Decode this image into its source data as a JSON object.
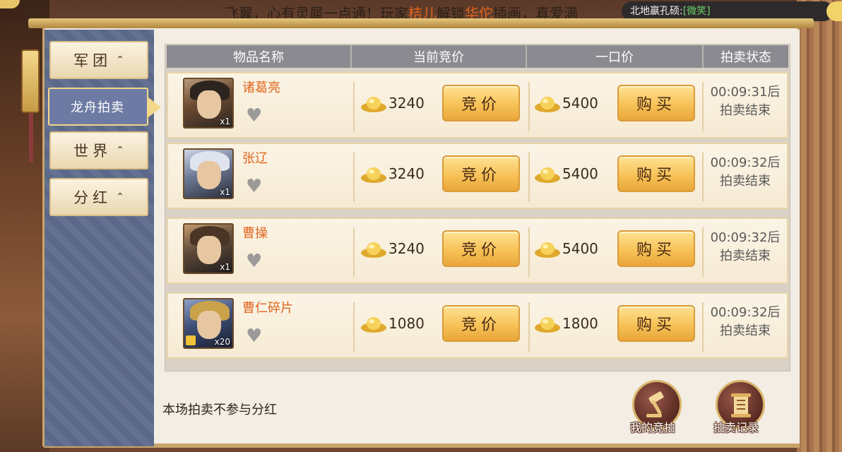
{
  "ticker": {
    "part1": "飞翼，心有灵犀一点通！玩家",
    "player": "桔儿",
    "part2": "解锁",
    "hero": "华佗",
    "part3": "插画，真爱满"
  },
  "chat": {
    "sender": "北地嬴孔硕:",
    "message": "[微笑]"
  },
  "sidebar": {
    "tabs": [
      {
        "label": "军团",
        "arrow": "⌃"
      },
      {
        "label": "龙舟拍卖"
      },
      {
        "label": "世界",
        "arrow": "⌃"
      },
      {
        "label": "分红",
        "arrow": "⌃"
      }
    ]
  },
  "table": {
    "headers": [
      "物品名称",
      "当前竞价",
      "一口价",
      "拍卖状态"
    ],
    "rows": [
      {
        "name": "诸葛亮",
        "count": "x1",
        "bid": "3240",
        "bid_label": "竞价",
        "buyout": "5400",
        "buy_label": "购买",
        "status_time": "00:09:31后",
        "status_text": "拍卖结束"
      },
      {
        "name": "张辽",
        "count": "x1",
        "bid": "3240",
        "bid_label": "竞价",
        "buyout": "5400",
        "buy_label": "购买",
        "status_time": "00:09:32后",
        "status_text": "拍卖结束"
      },
      {
        "name": "曹操",
        "count": "x1",
        "bid": "3240",
        "bid_label": "竞价",
        "buyout": "5400",
        "buy_label": "购买",
        "status_time": "00:09:32后",
        "status_text": "拍卖结束"
      },
      {
        "name": "曹仁碎片",
        "count": "x20",
        "bid": "1080",
        "bid_label": "竞价",
        "buyout": "1800",
        "buy_label": "购买",
        "status_time": "00:09:32后",
        "status_text": "拍卖结束"
      }
    ]
  },
  "footer": {
    "note": "本场拍卖不参与分红",
    "my_bids_label": "我的竞拍",
    "records_label": "拍卖记录"
  },
  "colors": {
    "highlight": "#e0651d",
    "sidebar": "#5e6b8d",
    "button": "#f7c257"
  },
  "icons": {
    "currency": "gold-ingot-icon",
    "favorite": "heart-icon",
    "my_bids": "gavel-icon",
    "records": "scroll-icon"
  }
}
